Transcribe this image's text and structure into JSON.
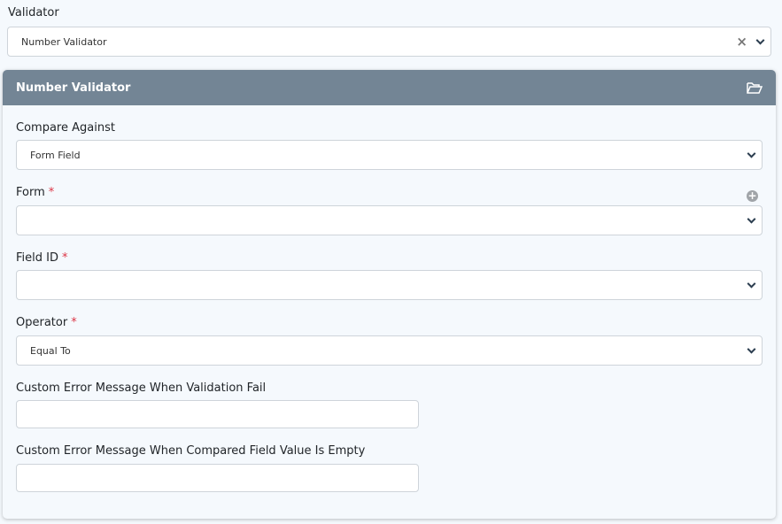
{
  "validator": {
    "label": "Validator",
    "value": "Number Validator"
  },
  "panel": {
    "title": "Number Validator",
    "compare_against": {
      "label": "Compare Against",
      "value": "Form Field"
    },
    "form": {
      "label": "Form",
      "required": "*",
      "value": ""
    },
    "field_id": {
      "label": "Field ID",
      "required": "*",
      "value": ""
    },
    "operator": {
      "label": "Operator",
      "required": "*",
      "value": "Equal To"
    },
    "error_fail": {
      "label": "Custom Error Message When Validation Fail",
      "value": ""
    },
    "error_empty": {
      "label": "Custom Error Message When Compared Field Value Is Empty",
      "value": ""
    }
  }
}
